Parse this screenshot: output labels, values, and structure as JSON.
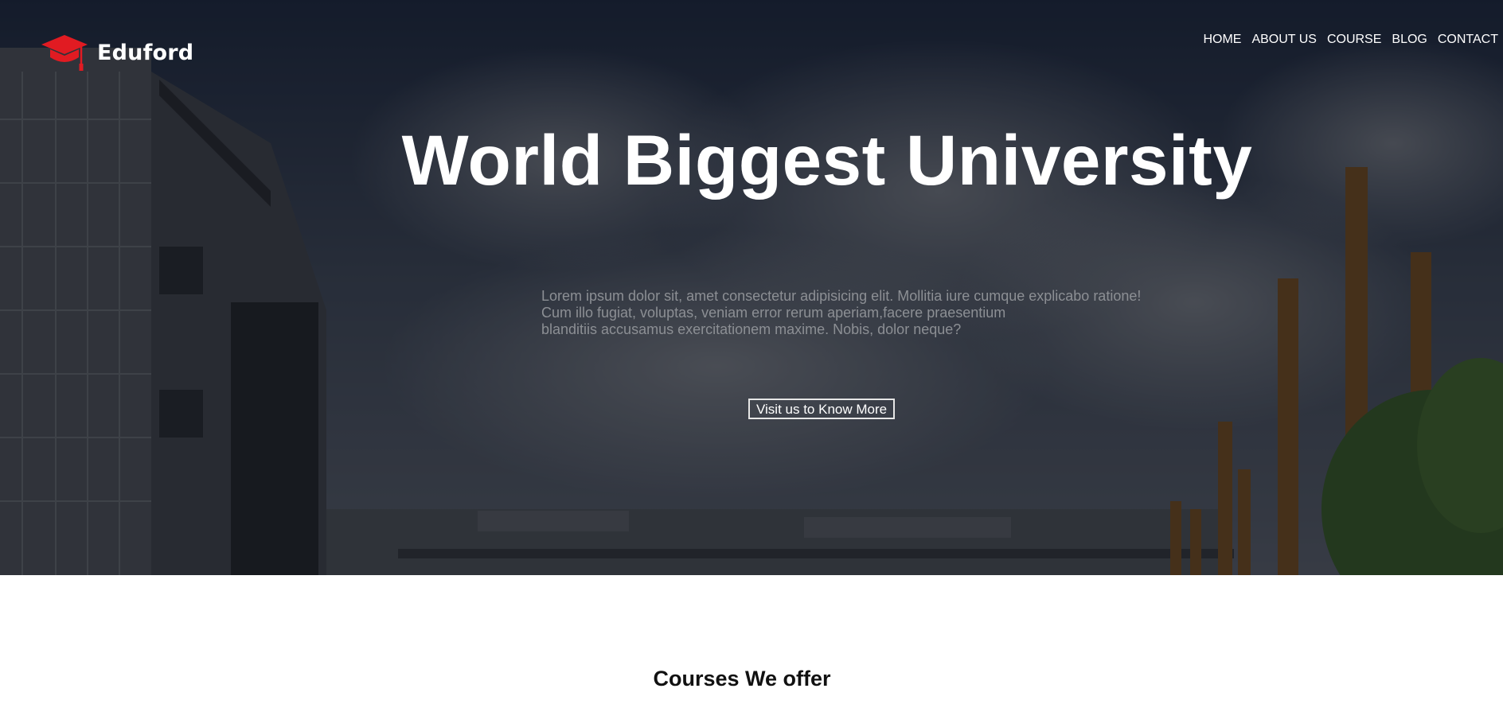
{
  "brand": {
    "name": "Eduford",
    "logo_icon": "graduation-cap-icon",
    "accent_color": "#e11b22"
  },
  "nav": {
    "items": [
      {
        "label": "HOME"
      },
      {
        "label": "ABOUT US"
      },
      {
        "label": "COURSE"
      },
      {
        "label": "BLOG"
      },
      {
        "label": "CONTACT"
      }
    ]
  },
  "hero": {
    "title": "World Biggest University",
    "description_lines": [
      "Lorem ipsum dolor sit, amet consectetur adipisicing elit. Mollitia iure cumque explicabo ratione!",
      "Cum illo fugiat, voluptas, veniam error rerum aperiam,facere praesentium",
      "blanditiis accusamus exercitationem maxime. Nobis, dolor neque?"
    ],
    "cta_label": "Visit us to Know More"
  },
  "courses": {
    "heading": "Courses We offer"
  }
}
